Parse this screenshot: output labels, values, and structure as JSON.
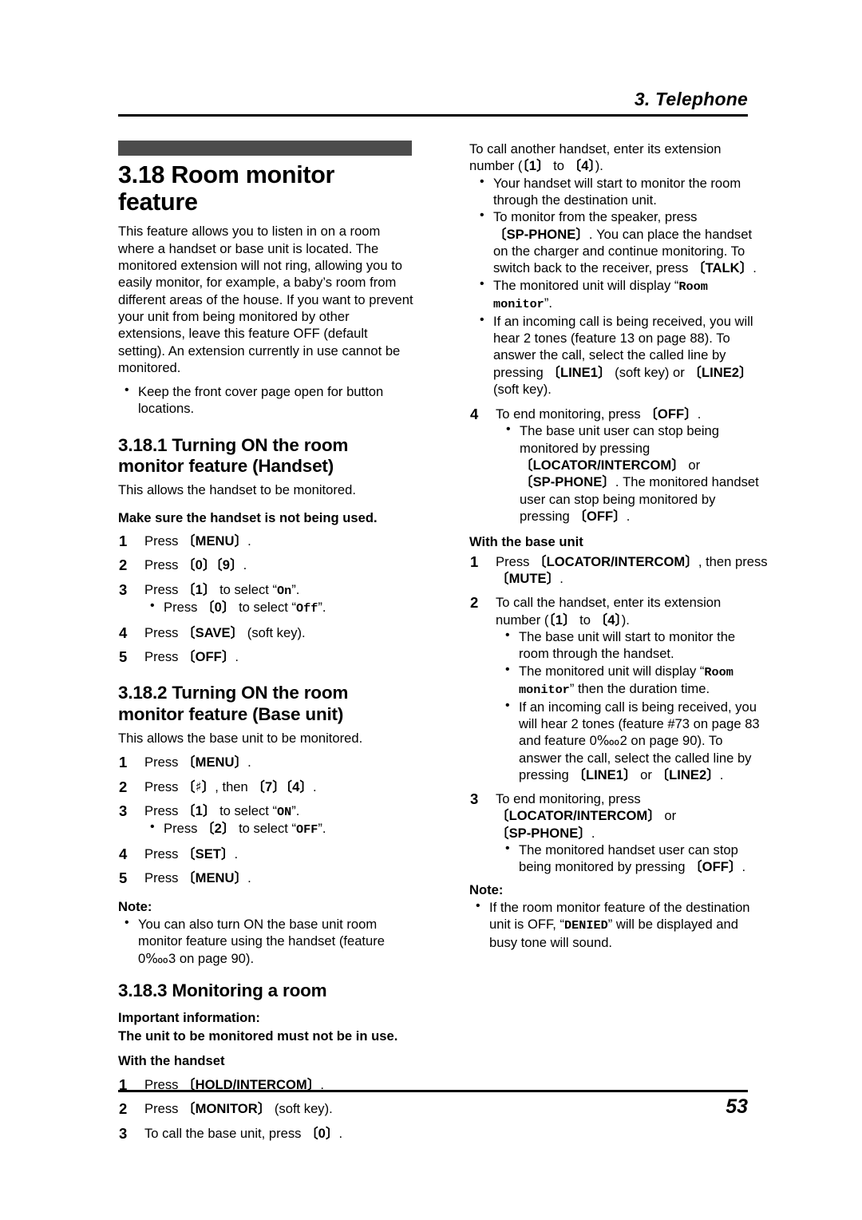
{
  "header": {
    "chapter_title": "3. Telephone"
  },
  "footer": {
    "page_number": "53"
  },
  "left_column": {
    "section": {
      "number": "3.18",
      "title": "3.18 Room monitor feature",
      "intro": "This feature allows you to listen in on a room where a handset or base unit is located. The monitored extension will not ring, allowing you to easily monitor, for example, a baby’s room from different areas of the house. If you want to prevent your unit from being monitored by other extensions, leave this feature OFF (default setting). An extension currently in use cannot be monitored.",
      "intro_bullet": "Keep the front cover page open for button locations."
    },
    "subsection_1": {
      "title": "3.18.1 Turning ON the room monitor feature (Handset)",
      "intro": "This allows the handset to be monitored.",
      "precondition": "Make sure the handset is not being used.",
      "steps": [
        {
          "pre": "Press ",
          "keys": [
            "MENU"
          ],
          "post": "."
        },
        {
          "pre": "Press ",
          "keys": [
            "0",
            "9"
          ],
          "post": "."
        },
        {
          "pre": "Press ",
          "keys": [
            "1"
          ],
          "post": " to select “On”.",
          "sub_bullet": {
            "pre": "Press ",
            "key": "0",
            "post": " to select “Off”."
          },
          "display_on": "On",
          "display_off": "Off"
        },
        {
          "pre": "Press ",
          "keys": [
            "SAVE"
          ],
          "post": " (soft key)."
        },
        {
          "pre": "Press ",
          "keys": [
            "OFF"
          ],
          "post": "."
        }
      ]
    },
    "subsection_2": {
      "title": "3.18.2 Turning ON the room monitor feature (Base unit)",
      "intro": "This allows the base unit to be monitored.",
      "steps": [
        {
          "pre": "Press ",
          "keys": [
            "MENU"
          ],
          "post": "."
        },
        {
          "pre": "Press ",
          "keys": [
            "♯"
          ],
          "mid": ", then ",
          "keys2": [
            "7",
            "4"
          ],
          "post": "."
        },
        {
          "pre": "Press ",
          "keys": [
            "1"
          ],
          "post": " to select “ON”.",
          "sub_bullet": {
            "pre": "Press ",
            "key": "2",
            "post": " to select “OFF”."
          },
          "display_on": "ON",
          "display_off": "OFF"
        },
        {
          "pre": "Press ",
          "keys": [
            "SET"
          ],
          "post": "."
        },
        {
          "pre": "Press ",
          "keys": [
            "MENU"
          ],
          "post": "."
        }
      ],
      "note_label": "Note:",
      "note_bullet": "You can also turn ON the base unit room monitor feature using the handset (feature 0‱3 on page 90)."
    },
    "subsection_3": {
      "title": "3.18.3 Monitoring a room",
      "important_label": "Important information:",
      "important_text": "The unit to be monitored must not be in use.",
      "with_handset_label": "With the handset",
      "steps": [
        {
          "pre": "Press ",
          "keys": [
            "HOLD/INTERCOM"
          ],
          "post": "."
        },
        {
          "pre": "Press ",
          "keys": [
            "MONITOR"
          ],
          "post": " (soft key)."
        },
        {
          "pre": "To call the base unit, press ",
          "keys": [
            "0"
          ],
          "post": "."
        }
      ]
    }
  },
  "right_column": {
    "continued_step": {
      "text_pre": "To call another handset, enter its extension number (",
      "key_a": "1",
      "text_mid": " to ",
      "key_b": "4",
      "text_post": ").",
      "bullets": [
        {
          "text": "Your handset will start to monitor the room through the destination unit."
        },
        {
          "text_1": "To monitor from the speaker, press ",
          "key_1": "SP-PHONE",
          "text_2": ". You can place the handset on the charger and continue monitoring. To switch back to the receiver, press ",
          "key_2": "TALK",
          "text_3": "."
        },
        {
          "text_1": "The monitored unit will display “",
          "display": "Room monitor",
          "text_2": "”."
        },
        {
          "text_1": "If an incoming call is being received, you will hear 2 tones (feature 13 on page 88). To answer the call, select the called line by pressing ",
          "key_1": "LINE1",
          "text_2": " (soft key) or ",
          "key_2": "LINE2",
          "text_3": " (soft key)."
        }
      ]
    },
    "step_4": {
      "number": "4",
      "text_pre": "To end monitoring, press ",
      "key": "OFF",
      "text_post": ".",
      "bullet": {
        "text_1": "The base unit user can stop being monitored by pressing ",
        "key_1": "LOCATOR/INTERCOM",
        "text_2": " or ",
        "key_2": "SP-PHONE",
        "text_3": ". The monitored handset user can stop being monitored by pressing ",
        "key_3": "OFF",
        "text_4": "."
      }
    },
    "with_base_unit_label": "With the base unit",
    "base_steps": [
      {
        "text_pre": "Press ",
        "key_1": "LOCATOR/INTERCOM",
        "text_mid": ", then press ",
        "key_2": "MUTE",
        "text_post": "."
      },
      {
        "text_pre": "To call the handset, enter its extension number (",
        "key_a": "1",
        "text_mid": " to ",
        "key_b": "4",
        "text_post": ").",
        "bullets": [
          {
            "text": "The base unit will start to monitor the room through the handset."
          },
          {
            "text_1": "The monitored unit will display “",
            "display": "Room monitor",
            "text_2": "” then the duration time."
          },
          {
            "text_1": "If an incoming call is being received, you will hear 2 tones (feature #73 on page 83 and feature 0‱2 on page 90). To answer the call, select the called line by pressing ",
            "key_1": "LINE1",
            "text_2": " or ",
            "key_2": "LINE2",
            "text_3": "."
          }
        ]
      },
      {
        "text_pre": "To end monitoring, press ",
        "key_1": "LOCATOR/INTERCOM",
        "text_mid": " or ",
        "key_2": "SP-PHONE",
        "text_post": ".",
        "bullet": {
          "text_1": "The monitored handset user can stop being monitored by pressing ",
          "key_1": "OFF",
          "text_2": "."
        }
      }
    ],
    "note_label": "Note:",
    "note_bullet": {
      "text_1": "If the room monitor feature of the destination unit is OFF, “",
      "display": "DENIED",
      "text_2": "” will be displayed and busy tone will sound."
    }
  },
  "colors": {
    "chapter_bar": "#4c4c4c",
    "text": "#000000",
    "background": "#ffffff"
  }
}
